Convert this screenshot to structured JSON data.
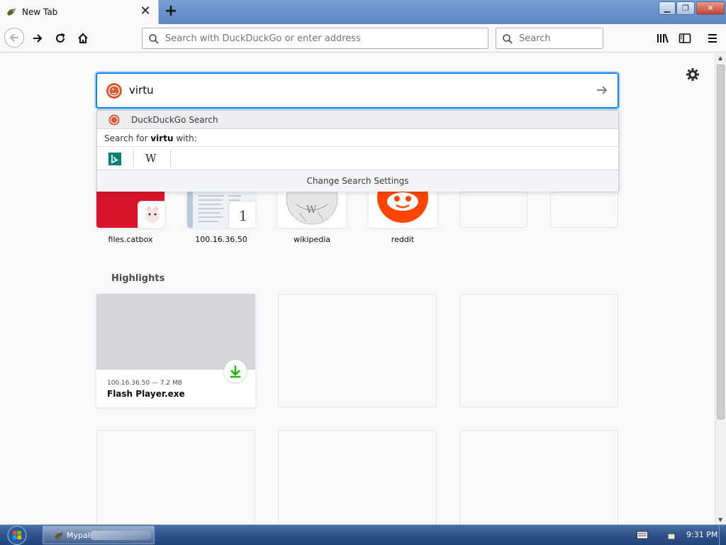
{
  "window": {
    "tab_title": "New Tab",
    "new_tab_symbol": "+",
    "close_tab_symbol": "✕",
    "controls": {
      "minimize": "▁",
      "maximize": "❐",
      "close": "✕"
    }
  },
  "toolbar": {
    "url_placeholder": "Search with DuckDuckGo or enter address",
    "search_placeholder": "Search"
  },
  "search": {
    "query": "virtu",
    "engine_suggestion": "DuckDuckGo Search",
    "search_for_prefix": "Search for ",
    "search_for_term": "virtu",
    "search_for_suffix": " with:",
    "one_off_engines": [
      "Bing",
      "Wikipedia"
    ],
    "wiki_glyph": "W",
    "change_settings": "Change Search Settings"
  },
  "top_sites": [
    {
      "label": "files.catbox"
    },
    {
      "label": "100.16.36.50",
      "badge": "1"
    },
    {
      "label": "wikipedia"
    },
    {
      "label": "reddit"
    }
  ],
  "highlights": {
    "title": "Highlights",
    "cards": [
      {
        "meta": "100.16.36.50 — 7.2 MB",
        "title": "Flash Player.exe"
      }
    ]
  },
  "taskbar": {
    "app_label": "Mypal",
    "time": "9:31 PM"
  },
  "colors": {
    "accent": "#0a84ff",
    "duckduckgo": "#de5833",
    "reddit": "#ff4500",
    "download_green": "#12bc00",
    "catbox_red": "#d8142c"
  }
}
